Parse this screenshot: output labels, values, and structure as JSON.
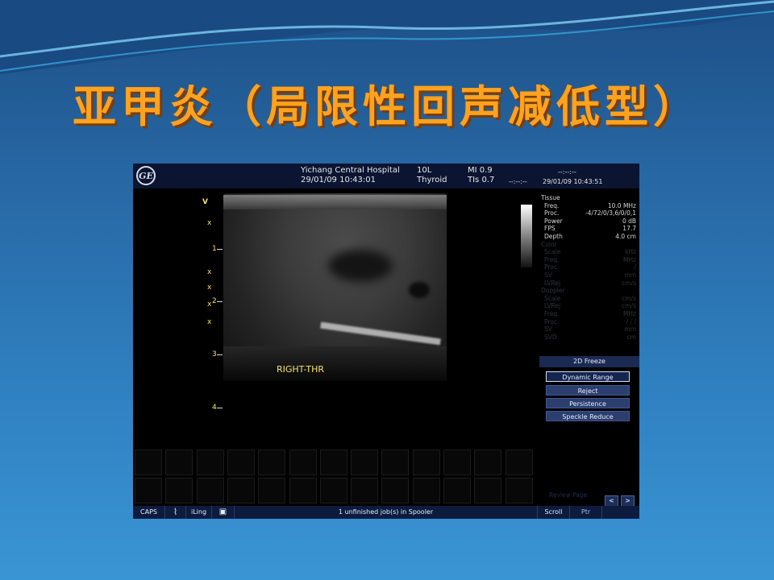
{
  "slide": {
    "title": "亚甲炎（局限性回声减低型）"
  },
  "ultrasound": {
    "hospital": "Yichang Central Hospital",
    "datetime_left": "29/01/09 10:43:01",
    "probe": "10L",
    "preset": "Thyroid",
    "mi": "MI 0.9",
    "tis": "TIs 0.7",
    "dashes_right": "--:--:--",
    "datetime_right": "29/01/09 10:43:51",
    "dashes_top": "--:--:--",
    "depth_ticks": [
      "1",
      "2",
      "3",
      "4"
    ],
    "side_marker": "V",
    "image_label": "RIGHT-THR",
    "params": [
      {
        "k": "Tissue",
        "v": "",
        "c": "t"
      },
      {
        "k": "Freq.",
        "v": "10.0  MHz",
        "c": "t"
      },
      {
        "k": "Proc.",
        "v": "-4/72/0/3,6/0/0,1",
        "c": "t"
      },
      {
        "k": "Power",
        "v": "0  dB",
        "c": "t"
      },
      {
        "k": "FPS",
        "v": "17.7",
        "c": "t"
      },
      {
        "k": "Depth",
        "v": "4.0  cm",
        "c": "t"
      },
      {
        "k": "Color",
        "v": "",
        "c": "g"
      },
      {
        "k": "Scale",
        "v": "kHz",
        "c": "g"
      },
      {
        "k": "Freq.",
        "v": "MHz",
        "c": "g"
      },
      {
        "k": "Proc.",
        "v": "/",
        "c": "g"
      },
      {
        "k": "SV",
        "v": "mm",
        "c": "g"
      },
      {
        "k": "LVRej",
        "v": "cm/s",
        "c": "g"
      },
      {
        "k": "Doppler",
        "v": "",
        "c": "g"
      },
      {
        "k": "Scale",
        "v": "cm/s",
        "c": "g"
      },
      {
        "k": "LVRej",
        "v": "cm/s",
        "c": "g"
      },
      {
        "k": "Freq.",
        "v": "MHz",
        "c": "g"
      },
      {
        "k": "Proc.",
        "v": "/ / /",
        "c": "g"
      },
      {
        "k": "SV",
        "v": "mm",
        "c": "g"
      },
      {
        "k": "SVD",
        "v": "cm",
        "c": "g"
      }
    ],
    "menu": {
      "header": "2D Freeze",
      "items": [
        "Dynamic Range",
        "Reject",
        "Persistence",
        "Speckle Reduce"
      ]
    },
    "review_page": "Review Page",
    "nav_prev": "<",
    "nav_next": ">",
    "status": {
      "caps": "CAPS",
      "ilog": "iLing",
      "spooler": "1 unfinished job(s) in Spooler",
      "scroll": "Scroll",
      "ptr": "Ptr"
    },
    "logo": "GE"
  }
}
